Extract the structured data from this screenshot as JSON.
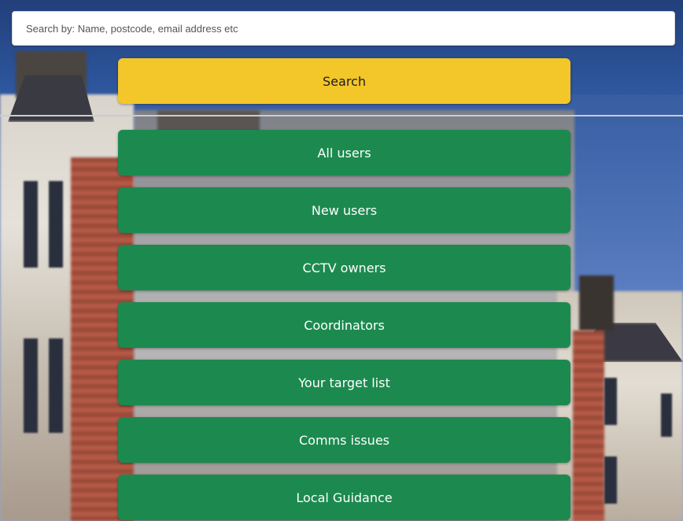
{
  "search": {
    "placeholder": "Search by: Name, postcode, email address etc",
    "button_label": "Search"
  },
  "menu": {
    "items": [
      {
        "label": "All users"
      },
      {
        "label": "New users"
      },
      {
        "label": "CCTV owners"
      },
      {
        "label": "Coordinators"
      },
      {
        "label": "Your target list"
      },
      {
        "label": "Comms issues"
      },
      {
        "label": "Local Guidance"
      }
    ]
  },
  "colors": {
    "search_button": "#f3c629",
    "menu_button": "#1c8a4f",
    "menu_text": "#ffffff",
    "background_sky": "#3d63a8"
  }
}
